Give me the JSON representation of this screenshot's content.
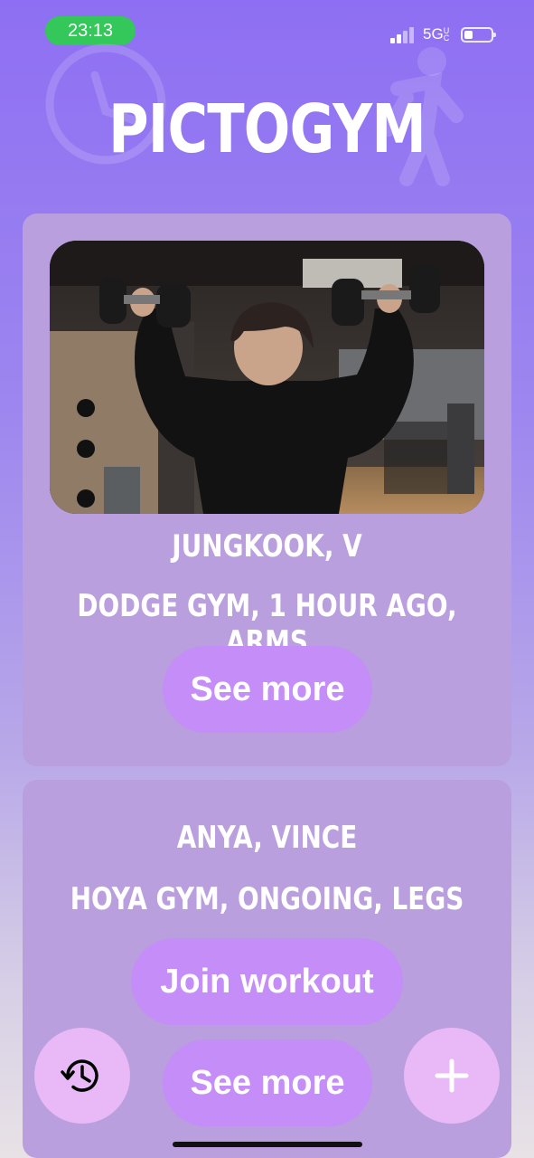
{
  "status_bar": {
    "time": "23:13",
    "network": "5G",
    "network_badge": "UC"
  },
  "app": {
    "title": "PICTOGYM"
  },
  "feed": [
    {
      "names": "JUNGKOOK, V",
      "details": "DODGE GYM, 1 HOUR AGO, ARMS",
      "see_more_label": "See more"
    },
    {
      "names": "ANYA, VINCE",
      "details": "HOYA GYM, ONGOING, LEGS",
      "join_label": "Join workout",
      "see_more_label": "See more"
    }
  ],
  "icons": {
    "history": "history-icon",
    "add": "plus-icon"
  },
  "colors": {
    "card": "#b99fdd",
    "button": "#c48df7",
    "fab": "#e8b8f7",
    "time_pill": "#34c759"
  }
}
